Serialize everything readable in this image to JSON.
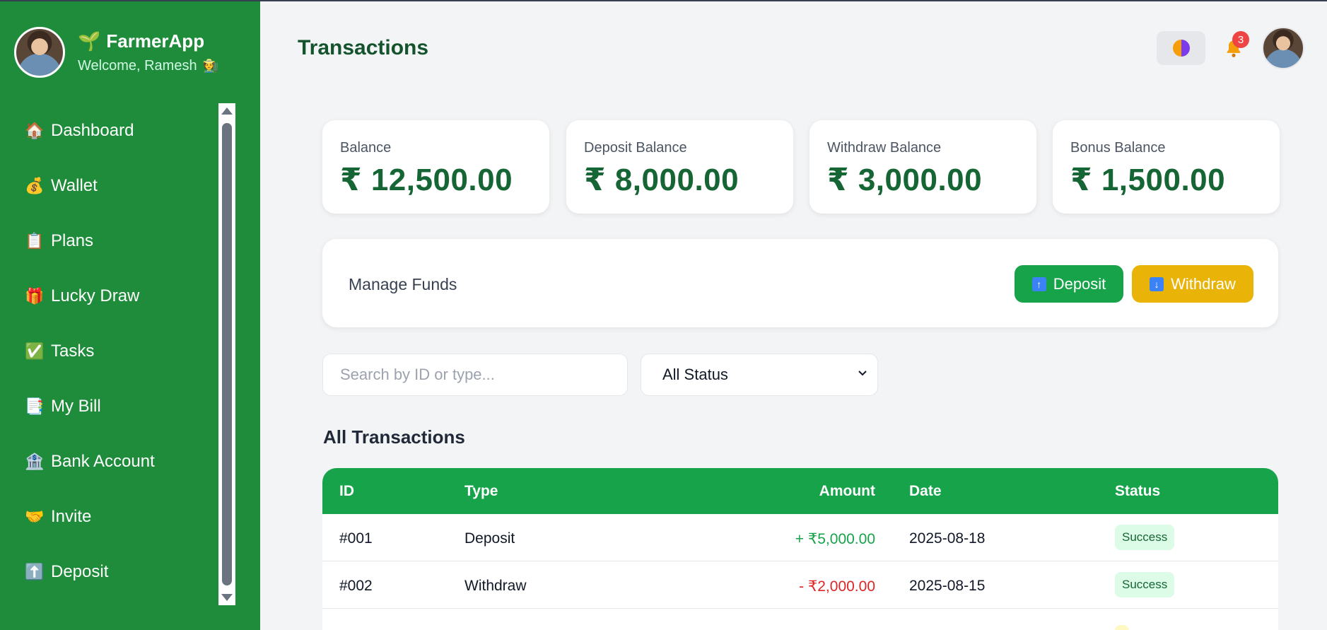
{
  "app": {
    "name": "FarmerApp",
    "brand_icon": "seedling-icon",
    "welcome": "Welcome, Ramesh"
  },
  "sidebar": {
    "items": [
      {
        "label": "Dashboard",
        "icon": "house-icon"
      },
      {
        "label": "Wallet",
        "icon": "money-bag-icon"
      },
      {
        "label": "Plans",
        "icon": "clipboard-icon"
      },
      {
        "label": "Lucky Draw",
        "icon": "gift-icon"
      },
      {
        "label": "Tasks",
        "icon": "check-box-icon"
      },
      {
        "label": "My Bill",
        "icon": "bill-icon"
      },
      {
        "label": "Bank Account",
        "icon": "bank-icon"
      },
      {
        "label": "Invite",
        "icon": "handshake-icon"
      },
      {
        "label": "Deposit",
        "icon": "up-arrow-icon"
      }
    ]
  },
  "header": {
    "title": "Transactions",
    "notification_count": "3"
  },
  "cards": [
    {
      "label": "Balance",
      "value": "₹ 12,500.00"
    },
    {
      "label": "Deposit Balance",
      "value": "₹ 8,000.00"
    },
    {
      "label": "Withdraw Balance",
      "value": "₹ 3,000.00"
    },
    {
      "label": "Bonus Balance",
      "value": "₹ 1,500.00"
    }
  ],
  "manage": {
    "label": "Manage Funds",
    "deposit_label": "Deposit",
    "withdraw_label": "Withdraw"
  },
  "filters": {
    "search_placeholder": "Search by ID or type...",
    "status_value": "All Status"
  },
  "transactions": {
    "title": "All Transactions",
    "columns": {
      "id": "ID",
      "type": "Type",
      "amount": "Amount",
      "date": "Date",
      "status": "Status"
    },
    "rows": [
      {
        "id": "#001",
        "type": "Deposit",
        "amount": "+ ₹5,000.00",
        "date": "2025-08-18",
        "status": "Success"
      },
      {
        "id": "#002",
        "type": "Withdraw",
        "amount": "- ₹2,000.00",
        "date": "2025-08-15",
        "status": "Success"
      }
    ]
  },
  "colors": {
    "sidebar": "#1e8c3a",
    "primary": "#16a34a",
    "warning": "#eab308",
    "title": "#14532d"
  }
}
